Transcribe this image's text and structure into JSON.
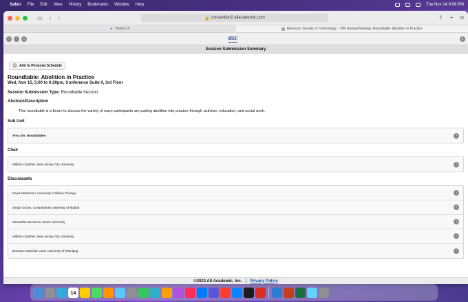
{
  "menubar": {
    "app": "Safari",
    "items": [
      "File",
      "Edit",
      "View",
      "History",
      "Bookmarks",
      "Window",
      "Help"
    ],
    "datetime": "Tue Nov 14  9:08 PM"
  },
  "browser": {
    "url": "convention2.allacademic.com",
    "tabs": [
      {
        "label": "Home / X",
        "active": false
      },
      {
        "label": "American Society of Criminology - 78th Annual Meeting: Roundtable: Abolition in Practice",
        "active": true
      }
    ]
  },
  "site": {
    "logo": "asc",
    "page_title": "Session Submission Summary"
  },
  "session": {
    "add_button": "Add to Personal Schedule",
    "title": "Roundtable: Abolition in Practice",
    "when": "Wed, Nov 15, 5:00 to 6:20pm, Conference Suite II, 3rd Floor",
    "type_label": "Session Submission Type:",
    "type_value": "Roundtable Session",
    "abstract_label": "Abstract/Description",
    "abstract": "This roundtable is a forum to discuss the variety of ways participants are putting abolition into practice through activism, education, and social work.",
    "subunit_label": "Sub Unit",
    "subunit": "Area XIV: Roundtables",
    "chair_label": "Chair",
    "chair": {
      "name": "William Calathes",
      "affil": ", New Jersey City University"
    },
    "discussants_label": "Discussants",
    "discussants": [
      {
        "name": "Kayla Martensen",
        "affil": ", University of Illinois Chicago"
      },
      {
        "name": "Sergio Grossi",
        "affil": ", Complutense University of Madrid"
      },
      {
        "name": "Samantha McAleese",
        "affil": ", Brock University"
      },
      {
        "name": "William Calathes",
        "affil": ", New Jersey City University"
      },
      {
        "name": "Bronwyn Dobchuk-Land",
        "affil": ", University of Winnipeg"
      }
    ]
  },
  "footer": {
    "copyright": "©2023 All Academic, Inc.",
    "separator": "|",
    "privacy": "Privacy Policy"
  },
  "dock": {
    "day": "14",
    "colors": [
      "#4a90d9",
      "#8e8e93",
      "#34aadc",
      "#ff3b30",
      "#ffcc00",
      "#4cd964",
      "#ff9500",
      "#5ac8fa",
      "#8e8e93",
      "#34c759",
      "#30b0c7",
      "#ff9f0a",
      "#af52de",
      "#ff2d55",
      "#007aff",
      "#5856d6",
      "#ff3b30",
      "#0a84ff",
      "#1c1c1e",
      "#d93025",
      "#2b7cd3",
      "#c43e1c",
      "#1d6f42",
      "#64d2ff",
      "#8e8e93"
    ]
  }
}
